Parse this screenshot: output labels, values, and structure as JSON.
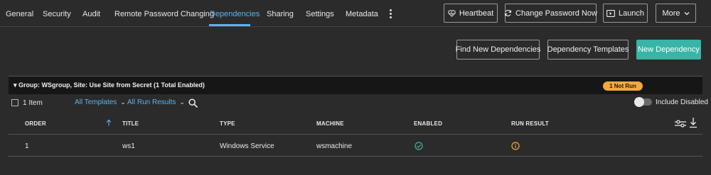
{
  "tabs": [
    {
      "label": "General"
    },
    {
      "label": "Security"
    },
    {
      "label": "Audit"
    },
    {
      "label": "Remote Password Changing"
    },
    {
      "label": "Dependencies"
    },
    {
      "label": "Sharing"
    },
    {
      "label": "Settings"
    },
    {
      "label": "Metadata"
    }
  ],
  "active_tab": "Dependencies",
  "header_actions": {
    "heartbeat": "Heartbeat",
    "change_password": "Change Password Now",
    "launch": "Launch",
    "more": "More"
  },
  "toolbar": {
    "find_dependencies": "Find New Dependencies",
    "dependency_templates": "Dependency Templates",
    "new_dependency": "New Dependency"
  },
  "group": {
    "label": "Group: WSgroup, Site: Use Site from Secret (1 Total Enabled)",
    "status_badge": "1 Not Run"
  },
  "filters": {
    "item_count": "1 Item",
    "templates": "All Templates",
    "run_results": "All Run Results",
    "include_disabled": "Include Disabled"
  },
  "table": {
    "columns": [
      "ORDER",
      "TITLE",
      "TYPE",
      "MACHINE",
      "ENABLED",
      "RUN RESULT"
    ],
    "rows": [
      {
        "order": "1",
        "title": "ws1",
        "type": "Windows Service",
        "machine": "wsmachine",
        "enabled": true,
        "run_result": "not-run"
      }
    ]
  },
  "icons": {
    "heartbeat": "heart-pulse-icon",
    "change_password": "refresh-icon",
    "launch": "launch-icon",
    "more": "chevron-down-icon",
    "search": "search-icon",
    "sort": "sort-ascending-icon",
    "enabled": "check-circle-icon",
    "run_result": "info-circle-icon",
    "column_settings": "sliders-icon",
    "download": "download-icon"
  },
  "colors": {
    "accent": "#5cb3f0",
    "primary_button": "#3ab4a6",
    "warning": "#f2a93b",
    "success": "#3ab4a6",
    "background": "#2b2b2b"
  }
}
